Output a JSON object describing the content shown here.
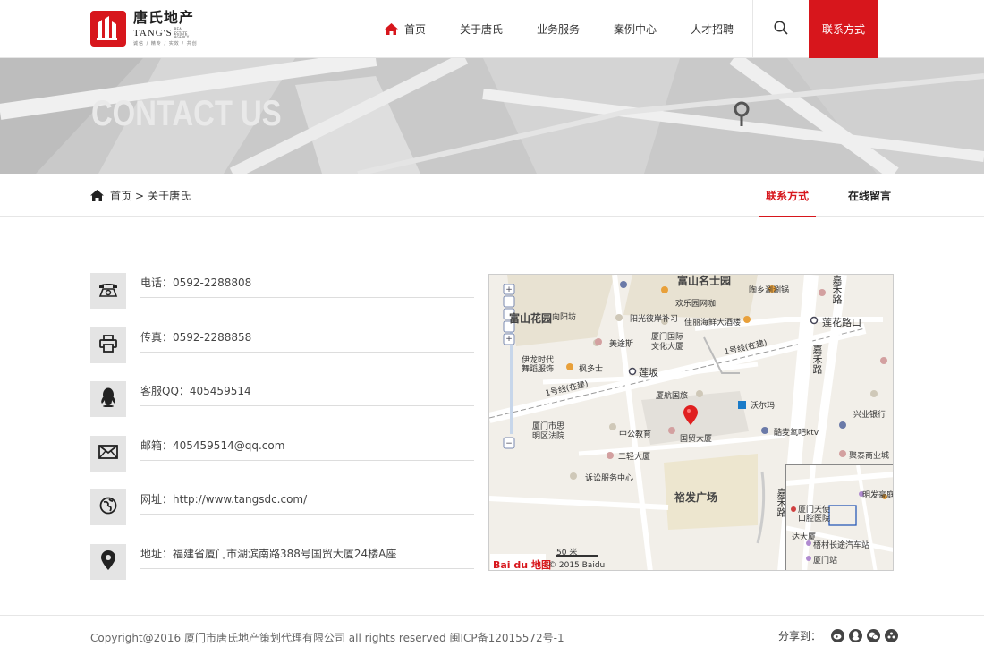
{
  "logo": {
    "cn": "唐氏地产",
    "en": "TANG'S",
    "en_small": "REAL ESTATE AGENCY",
    "tagline": "诚信 / 精专 / 实效 / 共创"
  },
  "nav": {
    "items": [
      {
        "label": "首页"
      },
      {
        "label": "关于唐氏"
      },
      {
        "label": "业务服务"
      },
      {
        "label": "案例中心"
      },
      {
        "label": "人才招聘"
      }
    ],
    "contact_label": "联系方式"
  },
  "banner": {
    "title": "CONTACT US"
  },
  "breadcrumb": {
    "home": "首页",
    "sep": ">",
    "current": "关于唐氏"
  },
  "subtabs": [
    {
      "label": "联系方式"
    },
    {
      "label": "在线留言"
    }
  ],
  "contacts": [
    {
      "icon": "phone-icon",
      "text": "电话：0592-2288808"
    },
    {
      "icon": "fax-icon",
      "text": "传真：0592-2288858"
    },
    {
      "icon": "qq-icon",
      "text": "客服QQ：405459514"
    },
    {
      "icon": "mail-icon",
      "text": "邮箱：405459514@qq.com"
    },
    {
      "icon": "globe-icon",
      "text": "网址：http://www.tangsdc.com/"
    },
    {
      "icon": "location-icon",
      "text": "地址：福建省厦门市湖滨南路388号国贸大厦24楼A座"
    }
  ],
  "map": {
    "labels": {
      "l1": "富山名士园",
      "l2": "陶乡涮涮锅",
      "l3": "欢乐园网咖",
      "l4": "向阳坊",
      "l5": "阳光彼岸补习",
      "l6": "佳丽海鲜大酒楼",
      "l7": "富山花园",
      "l8": "美途斯",
      "l9": "厦门国际",
      "l10": "文化大厦",
      "l11": "伊龙时代",
      "l12": "舞蹈服饰",
      "l13": "枫多士",
      "l14": "莲坂",
      "l15": "1号线(在建)",
      "l16": "1号线(在建)",
      "l17": "莲花路口",
      "l18": "厦航国旅",
      "l19": "沃尔玛",
      "l20": "厦门市思",
      "l21": "明区法院",
      "l22": "中公教育",
      "l23": "国贸大厦",
      "l24": "酷麦氧吧ktv",
      "l25": "兴业银行",
      "l26": "二轻大厦",
      "l27": "聚泰商业城",
      "l28": "诉讼服务中心",
      "l29": "裕发广场",
      "l30": "嘉禾路",
      "l31": "嘉禾路",
      "l32": "嘉禾路",
      "l33": "厦门天使",
      "l34": "口腔医院",
      "l35": "明发豪庭",
      "l36": "达大厦",
      "l37": "梧村长途汽车站",
      "l38": "厦门站"
    },
    "scale": "50 米",
    "copyright": "© 2015 Baidu",
    "brand": "Bai du 地图"
  },
  "footer": {
    "copyright": "Copyright@2016 厦门市唐氏地产策划代理有限公司 all rights reserved 闽ICP备12015572号-1",
    "share_label": "分享到："
  },
  "colors": {
    "accent": "#d7161c",
    "icon_bg": "#e4e4e4"
  }
}
